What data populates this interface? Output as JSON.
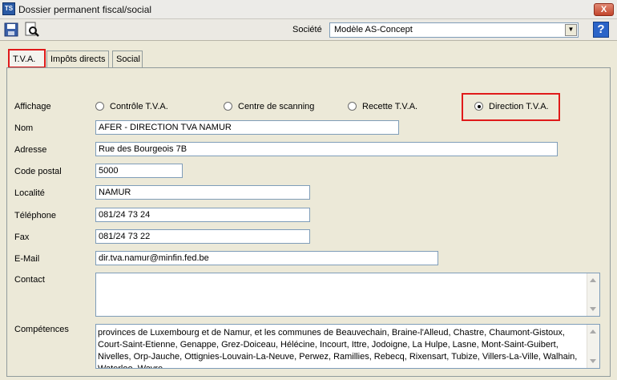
{
  "window": {
    "title": "Dossier permanent fiscal/social",
    "app_icon_text": "TS",
    "close_label": "X"
  },
  "toolbar": {
    "societe_label": "Société",
    "societe_value": "Modèle AS-Concept",
    "help_label": "?"
  },
  "tabs": [
    {
      "label": "T.V.A.",
      "active": true
    },
    {
      "label": "Impôts directs",
      "active": false
    },
    {
      "label": "Social",
      "active": false
    }
  ],
  "affichage": {
    "label": "Affichage",
    "options": [
      {
        "label": "Contrôle T.V.A.",
        "selected": false
      },
      {
        "label": "Centre de scanning",
        "selected": false
      },
      {
        "label": "Recette T.V.A.",
        "selected": false
      },
      {
        "label": "Direction T.V.A.",
        "selected": true
      }
    ]
  },
  "form": {
    "nom": {
      "label": "Nom",
      "value": "AFER - DIRECTION TVA NAMUR"
    },
    "adresse": {
      "label": "Adresse",
      "value": "Rue des Bourgeois 7B"
    },
    "code_postal": {
      "label": "Code postal",
      "value": "5000"
    },
    "localite": {
      "label": "Localité",
      "value": "NAMUR"
    },
    "telephone": {
      "label": "Téléphone",
      "value": "081/24 73 24"
    },
    "fax": {
      "label": "Fax",
      "value": "081/24 73 22"
    },
    "email": {
      "label": "E-Mail",
      "value": "dir.tva.namur@minfin.fed.be"
    },
    "contact": {
      "label": "Contact",
      "value": ""
    },
    "competences": {
      "label": "Compétences",
      "value": "provinces de Luxembourg et de Namur, et les communes de Beauvechain, Braine-l'Alleud, Chastre, Chaumont-Gistoux, Court-Saint-Etienne, Genappe, Grez-Doiceau, Hélécine, Incourt, Ittre, Jodoigne, La Hulpe, Lasne, Mont-Saint-Guibert, Nivelles, Orp-Jauche, Ottignies-Louvain-La-Neuve, Perwez, Ramillies, Rebecq, Rixensart, Tubize, Villers-La-Ville, Walhain, Waterloo, Wavre"
    }
  },
  "colors": {
    "highlight": "#e01a1a",
    "window_bg": "#ece9d8",
    "field_border": "#7f9db9"
  }
}
